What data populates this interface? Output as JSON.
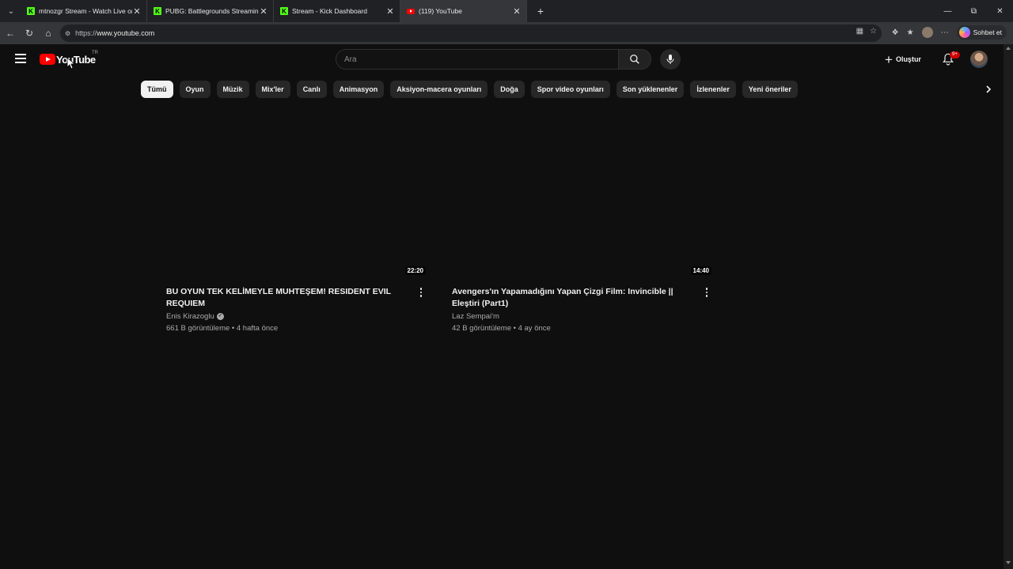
{
  "browser": {
    "tabs": [
      {
        "title": "mtnozgr Stream - Watch Live on K",
        "favicon": "kick-icon"
      },
      {
        "title": "PUBG: Battlegrounds Streaming -",
        "favicon": "kick-icon"
      },
      {
        "title": "Stream - Kick Dashboard",
        "favicon": "kick-icon"
      },
      {
        "title": "(119) YouTube",
        "favicon": "youtube-icon"
      }
    ],
    "url_scheme": "https://",
    "url_host": "www.youtube.com",
    "copilot_label": "Sohbet et"
  },
  "youtube": {
    "logo_text": "YouTube",
    "country_code": "TR",
    "search_placeholder": "Ara",
    "create_label": "Oluştur",
    "notification_badge": "9+",
    "chips": [
      "Tümü",
      "Oyun",
      "Müzik",
      "Mix'ler",
      "Canlı",
      "Animasyon",
      "Aksiyon-macera oyunları",
      "Doğa",
      "Spor video oyunları",
      "Son yüklenenler",
      "İzlenenler",
      "Yeni öneriler"
    ],
    "active_chip": 0,
    "videos": [
      {
        "duration": "22:20",
        "title": "BU OYUN TEK KELİMEYLE MUHTEŞEM! RESIDENT EVIL REQUIEM",
        "channel": "Enis Kirazoglu",
        "verified": true,
        "stats": "661 B görüntüleme • 4 hafta önce"
      },
      {
        "duration": "14:40",
        "title": "Avengers'ın Yapamadığını Yapan Çizgi Film: Invincible || Eleştiri (Part1)",
        "channel": "Laz Sempai'm",
        "verified": false,
        "stats": "42 B görüntüleme • 4 ay önce"
      }
    ]
  },
  "colors": {
    "background": "#0f0f0f",
    "youtube_red": "#ff0000",
    "kick_green": "#53fc18",
    "chip_bg": "#272727",
    "chip_active_bg": "#f1f1f1"
  }
}
